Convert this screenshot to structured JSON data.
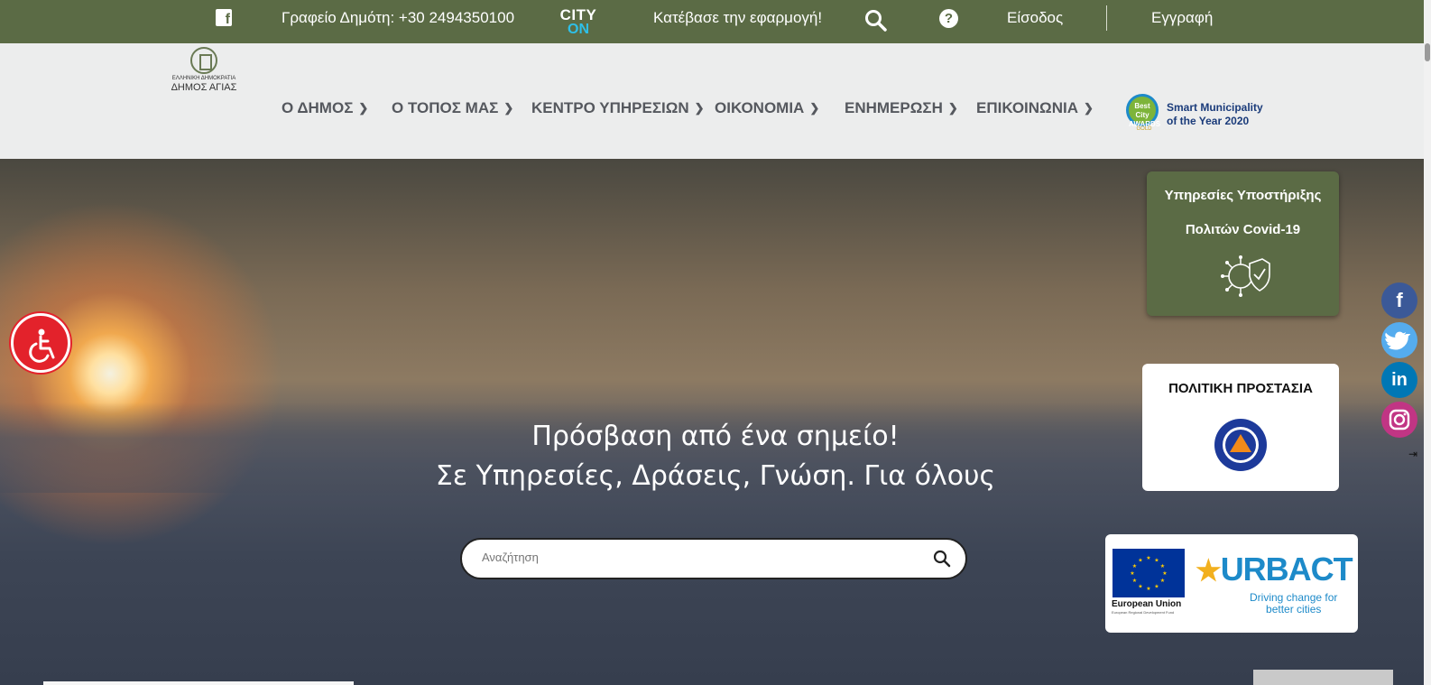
{
  "topbar": {
    "facebook_icon": "facebook-square-icon",
    "office": "Γραφείο Δημότη: +30 2494350100",
    "cityon_line1": "CITY",
    "cityon_line2": "ON",
    "app": "Κατέβασε την εφαρμογή!",
    "search_icon": "search-icon",
    "help_icon": "question-circle-icon",
    "help_glyph": "?",
    "login": "Είσοδος",
    "register": "Εγγραφή",
    "bg_color": "#5b6b45"
  },
  "logo": {
    "small_text": "ΕΛΛΗΝΙΚΗ ΔΗΜΟΚΡΑΤΙΑ",
    "name": "ΔΗΜΟΣ ΑΓΙΑΣ"
  },
  "nav": {
    "items": [
      {
        "label": "Ο ΔΗΜΟΣ"
      },
      {
        "label": "Ο ΤΟΠΟΣ ΜΑΣ"
      },
      {
        "label": "ΚΕΝΤΡΟ ΥΠΗΡΕΣΙΩΝ"
      },
      {
        "label": "ΟΙΚΟΝΟΜΙΑ"
      },
      {
        "label": "ΕΝΗΜΕΡΩΣΗ"
      },
      {
        "label": "ΕΠΙΚΟΙΝΩΝΙΑ"
      }
    ],
    "badge_text": "Best City AWARDS",
    "badge_gold": "GOLD",
    "smart_line1": "Smart Municipality",
    "smart_line2": "of the Year 2020"
  },
  "hero": {
    "title": "Πρόσβαση από ένα σημείο!",
    "subtitle": "Σε Υπηρεσίες, Δράσεις, Γνώση. Για όλους",
    "search_placeholder": "Αναζήτηση"
  },
  "cards": {
    "covid_line1": "Υπηρεσίες Υποστήριξης",
    "covid_line2": "Πολιτών Covid-19",
    "civil_protection": "ΠΟΛΙΤΙΚΗ ΠΡΟΣΤΑΣΙΑ",
    "eu_label": "European Union",
    "eu_sub": "European Regional Development Fund",
    "urbact": "URBACT",
    "urbact_tag1": "Driving change for",
    "urbact_tag2": "better cities"
  },
  "social": {
    "facebook": "f",
    "twitter": "t",
    "linkedin": "in",
    "instagram": "ig",
    "hide": "⇥"
  },
  "colors": {
    "accent_green": "#5b6b45",
    "nav_text": "#55585e",
    "facebook": "#3b5998",
    "twitter": "#55acee",
    "linkedin": "#0077b5",
    "instagram": "#c13584",
    "accessibility": "#e3222b"
  }
}
